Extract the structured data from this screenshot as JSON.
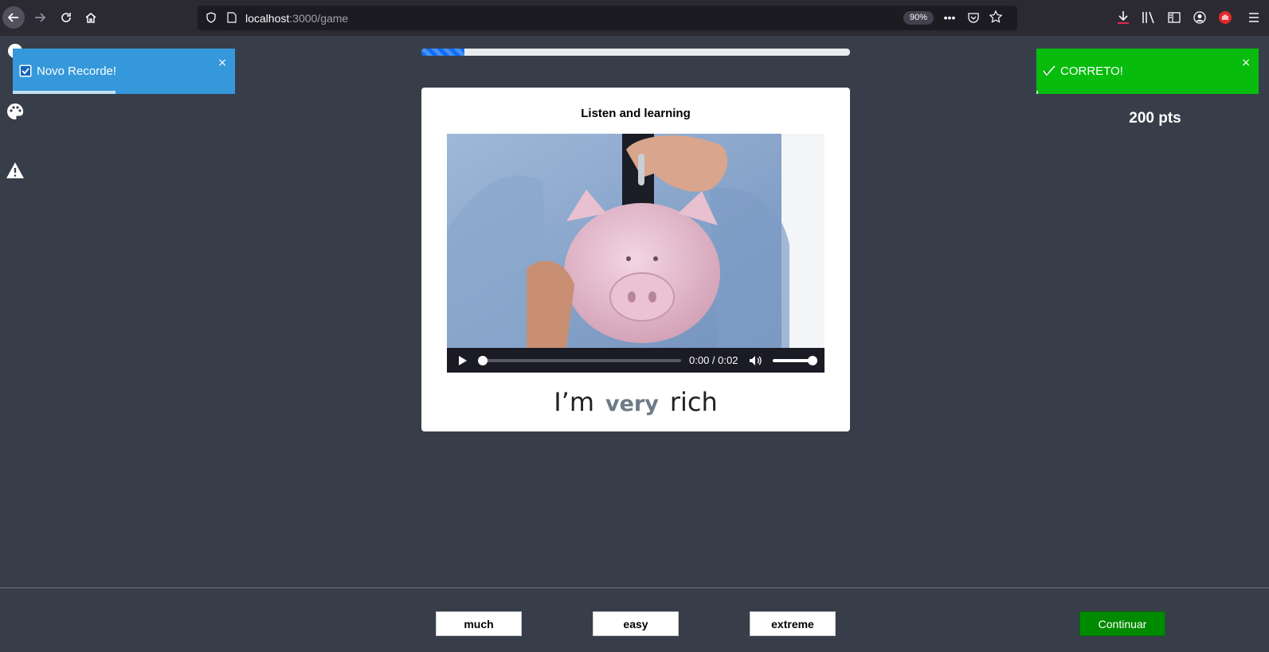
{
  "browser": {
    "url_host": "localhost",
    "url_path": ":3000/game",
    "zoom": "90%"
  },
  "toasts": {
    "record": {
      "text": "Novo Recorde!",
      "close": "×"
    },
    "correct": {
      "text": "CORRETO!",
      "close": "×"
    }
  },
  "score": {
    "label": "200 pts"
  },
  "progress": {
    "fraction": 0.1
  },
  "card": {
    "title": "Listen and learning",
    "video": {
      "time": "0:00 / 0:02"
    },
    "sentence": {
      "before": "I’m",
      "blank": "very",
      "after": "rich"
    }
  },
  "options": [
    "much",
    "easy",
    "extreme"
  ],
  "continue_label": "Continuar",
  "colors": {
    "correct": "#07bc0c",
    "info": "#3498db",
    "background": "#373e4a",
    "continue": "#008a00"
  }
}
